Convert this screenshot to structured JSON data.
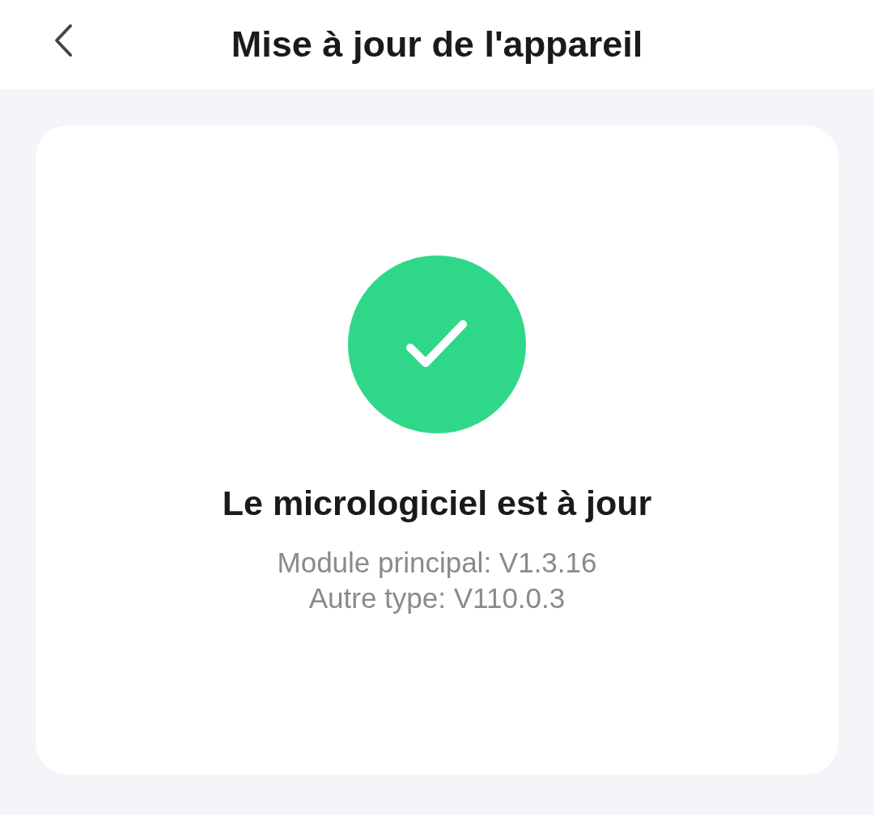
{
  "header": {
    "title": "Mise à jour de l'appareil"
  },
  "status": {
    "kind": "success",
    "heading": "Le micrologiciel est à jour",
    "versions": [
      "Module principal: V1.3.16",
      "Autre type: V110.0.3"
    ]
  }
}
